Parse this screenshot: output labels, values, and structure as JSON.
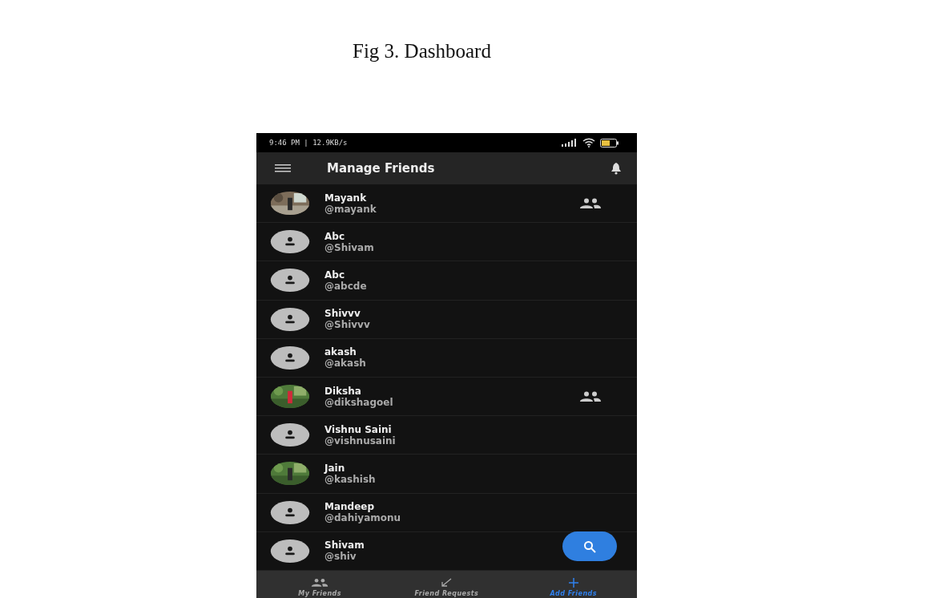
{
  "caption": "Fig 3. Dashboard",
  "status_bar": {
    "time": "9:46 PM | 12.9KB/s"
  },
  "app_bar": {
    "title": "Manage Friends"
  },
  "friends": [
    {
      "name": "Mayank",
      "handle": "@mayank",
      "is_friend": true
    },
    {
      "name": "Abc",
      "handle": "@Shivam",
      "kind": "default",
      "is_friend": false
    },
    {
      "name": "Abc",
      "handle": "@abcde",
      "kind": "default",
      "is_friend": false
    },
    {
      "name": "Shivvv",
      "handle": "@Shivvv",
      "kind": "default",
      "is_friend": false
    },
    {
      "name": "akash",
      "handle": "@akash",
      "kind": "default",
      "is_friend": false
    },
    {
      "name": "Diksha",
      "handle": "@dikshagoel",
      "is_friend": true
    },
    {
      "name": "Vishnu Saini",
      "handle": "@vishnusaini",
      "kind": "default",
      "is_friend": false
    },
    {
      "name": "Jain",
      "handle": "@kashish",
      "is_friend": false
    },
    {
      "name": "Mandeep",
      "handle": "@dahiyamonu",
      "kind": "default",
      "is_friend": false
    },
    {
      "name": "Shivam",
      "handle": "@shiv",
      "kind": "default",
      "is_friend": false
    }
  ],
  "bottom_nav": [
    {
      "label": "My Friends",
      "kind": "people",
      "selected": false
    },
    {
      "label": "Friend Requests",
      "kind": "arrow",
      "selected": false
    },
    {
      "label": "Add Friends",
      "kind": "plus",
      "selected": true
    }
  ]
}
